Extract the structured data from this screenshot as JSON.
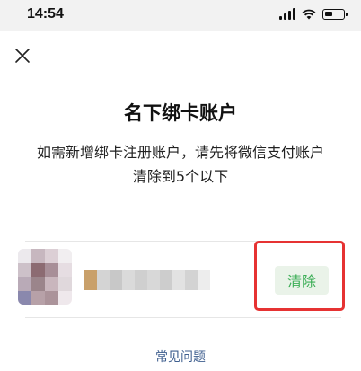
{
  "status_bar": {
    "time": "14:54",
    "battery_level": 0.45
  },
  "header": {
    "close_icon": "close-icon"
  },
  "title": "名下绑卡账户",
  "description": "如需新增绑卡注册账户，请先将微信支付账户清除到5个以下",
  "account": {
    "clear_label": "清除"
  },
  "footer": {
    "faq_label": "常见问题"
  },
  "colors": {
    "accent_green": "#3cae56",
    "button_bg": "#eaf3e9",
    "highlight_red": "#e63232",
    "link_blue": "#3f5f8f"
  }
}
